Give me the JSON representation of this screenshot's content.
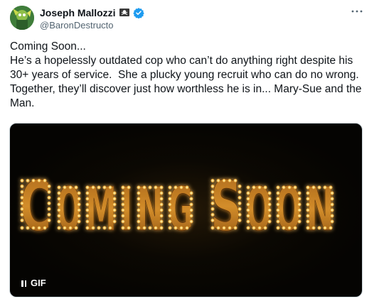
{
  "author": {
    "display_name": "Joseph Mallozzi",
    "handle": "@BaronDestructo",
    "name_emoji": "pirate-flag-icon",
    "verified": true,
    "verified_color": "#1d9bf0"
  },
  "menu": {
    "more_label": "···"
  },
  "tweet": {
    "lines": [
      "Coming Soon...",
      "He’s a hopelessly outdated cop who can’t do anything right despite his 30+ years of service.  She a plucky young recruit who can do no wrong. Together, they’ll discover just how worthless he is in... Mary-Sue and the Man."
    ]
  },
  "media": {
    "type": "gif",
    "marquee_text": "COMING SOON",
    "badge_label": "GIF",
    "bulb_color": "#ffd36a",
    "letter_color": "#c8801e"
  },
  "colors": {
    "text": "#0f1419",
    "secondary": "#536471",
    "media_bg": "#050402"
  }
}
